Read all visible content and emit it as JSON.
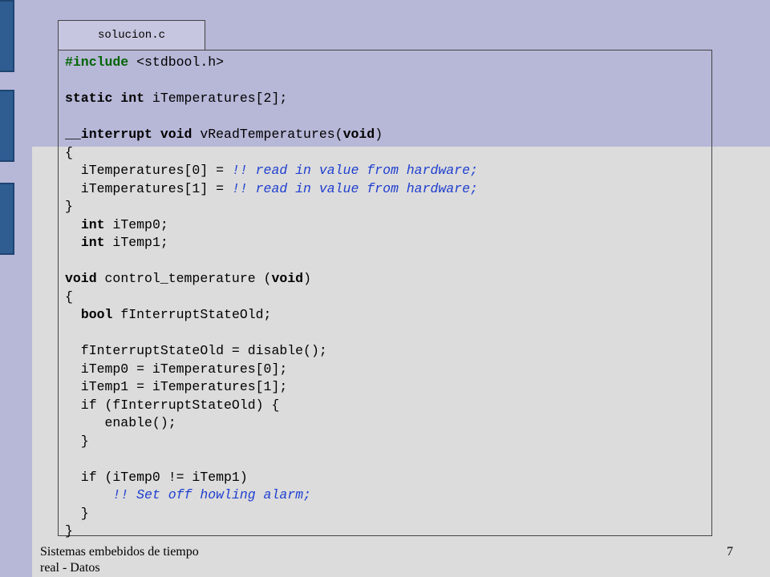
{
  "slide": {
    "file_tab_label": "solucion.c",
    "footer_title": "Sistemas embebidos de tiempo real - Datos",
    "page_number": "7"
  },
  "code_lines": [
    [
      {
        "t": "#include",
        "c": "pp"
      },
      {
        "t": " <stdbool.h>",
        "c": ""
      }
    ],
    null,
    [
      {
        "t": "static int",
        "c": "kw"
      },
      {
        "t": " iTemperatures[2];",
        "c": ""
      }
    ],
    null,
    [
      {
        "t": "__interrupt void",
        "c": "kw"
      },
      {
        "t": " vReadTemperatures(",
        "c": ""
      },
      {
        "t": "void",
        "c": "kw"
      },
      {
        "t": ")",
        "c": ""
      }
    ],
    [
      {
        "t": "{",
        "c": ""
      }
    ],
    [
      {
        "t": "  iTemperatures[0] = ",
        "c": ""
      },
      {
        "t": "!! read in value from hardware;",
        "c": "cm"
      }
    ],
    [
      {
        "t": "  iTemperatures[1] = ",
        "c": ""
      },
      {
        "t": "!! read in value from hardware;",
        "c": "cm"
      }
    ],
    [
      {
        "t": "}",
        "c": ""
      }
    ],
    [
      {
        "t": "  ",
        "c": ""
      },
      {
        "t": "int",
        "c": "kw"
      },
      {
        "t": " iTemp0;",
        "c": ""
      }
    ],
    [
      {
        "t": "  ",
        "c": ""
      },
      {
        "t": "int",
        "c": "kw"
      },
      {
        "t": " iTemp1;",
        "c": ""
      }
    ],
    null,
    [
      {
        "t": "void",
        "c": "kw"
      },
      {
        "t": " control_temperature (",
        "c": ""
      },
      {
        "t": "void",
        "c": "kw"
      },
      {
        "t": ")",
        "c": ""
      }
    ],
    [
      {
        "t": "{",
        "c": ""
      }
    ],
    [
      {
        "t": "  ",
        "c": ""
      },
      {
        "t": "bool",
        "c": "kw"
      },
      {
        "t": " fInterruptStateOld;",
        "c": ""
      }
    ],
    null,
    [
      {
        "t": "  fInterruptStateOld = disable();",
        "c": ""
      }
    ],
    [
      {
        "t": "  iTemp0 = iTemperatures[0];",
        "c": ""
      }
    ],
    [
      {
        "t": "  iTemp1 = iTemperatures[1];",
        "c": ""
      }
    ],
    [
      {
        "t": "  if (fInterruptStateOld) {",
        "c": ""
      }
    ],
    [
      {
        "t": "     enable();",
        "c": ""
      }
    ],
    [
      {
        "t": "  }",
        "c": ""
      }
    ],
    null,
    [
      {
        "t": "  if (iTemp0 != iTemp1)",
        "c": ""
      }
    ],
    [
      {
        "t": "      ",
        "c": ""
      },
      {
        "t": "!! Set off howling alarm;",
        "c": "cm"
      }
    ],
    [
      {
        "t": "  }",
        "c": ""
      }
    ],
    [
      {
        "t": "}",
        "c": ""
      }
    ]
  ]
}
